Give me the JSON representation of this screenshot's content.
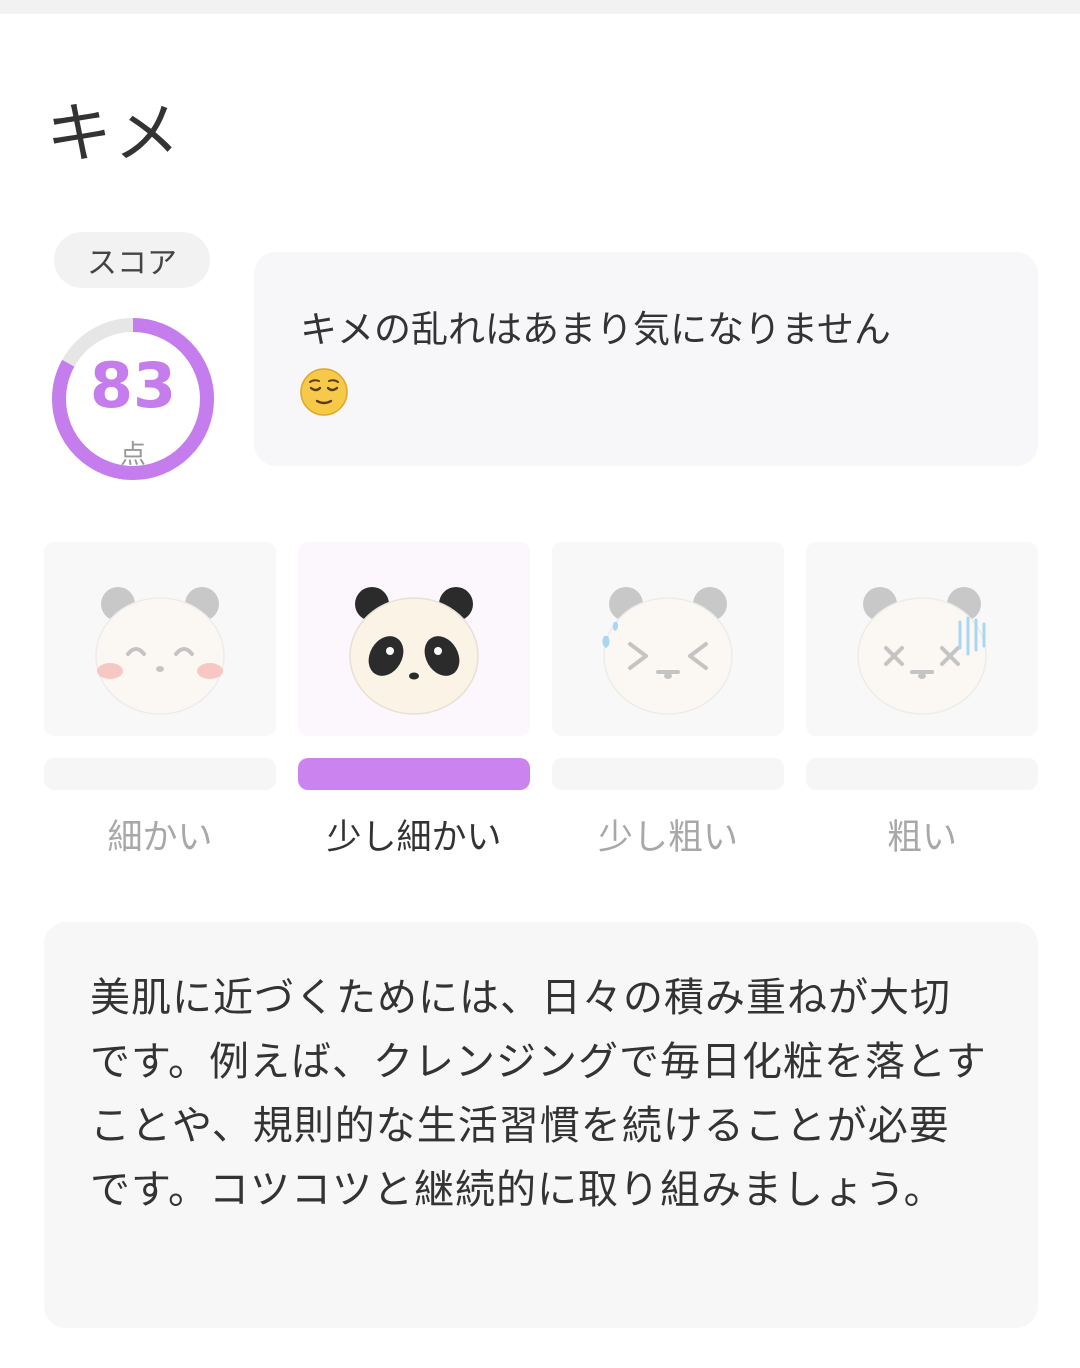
{
  "header": {
    "title": "キメ"
  },
  "score": {
    "label": "スコア",
    "value": 83,
    "value_text": "83",
    "unit": "点",
    "ring_fraction": 0.83,
    "accent_color": "#c57cec",
    "track_color": "#e6e6e6"
  },
  "message": {
    "text": "キメの乱れはあまり気になりません",
    "emoji": "relieved-face-icon"
  },
  "levels": {
    "selected_index": 1,
    "items": [
      {
        "label": "細かい",
        "icon": "smiling-panda-icon"
      },
      {
        "label": "少し細かい",
        "icon": "neutral-panda-icon"
      },
      {
        "label": "少し粗い",
        "icon": "squinting-panda-icon"
      },
      {
        "label": "粗い",
        "icon": "dizzy-panda-icon"
      }
    ]
  },
  "advice": {
    "text": "美肌に近づくためには、日々の積み重ねが大切です。例えば、クレンジングで毎日化粧を落とすことや、規則的な生活習慣を続けることが必要です。コツコツと継続的に取り組みましょう。"
  }
}
